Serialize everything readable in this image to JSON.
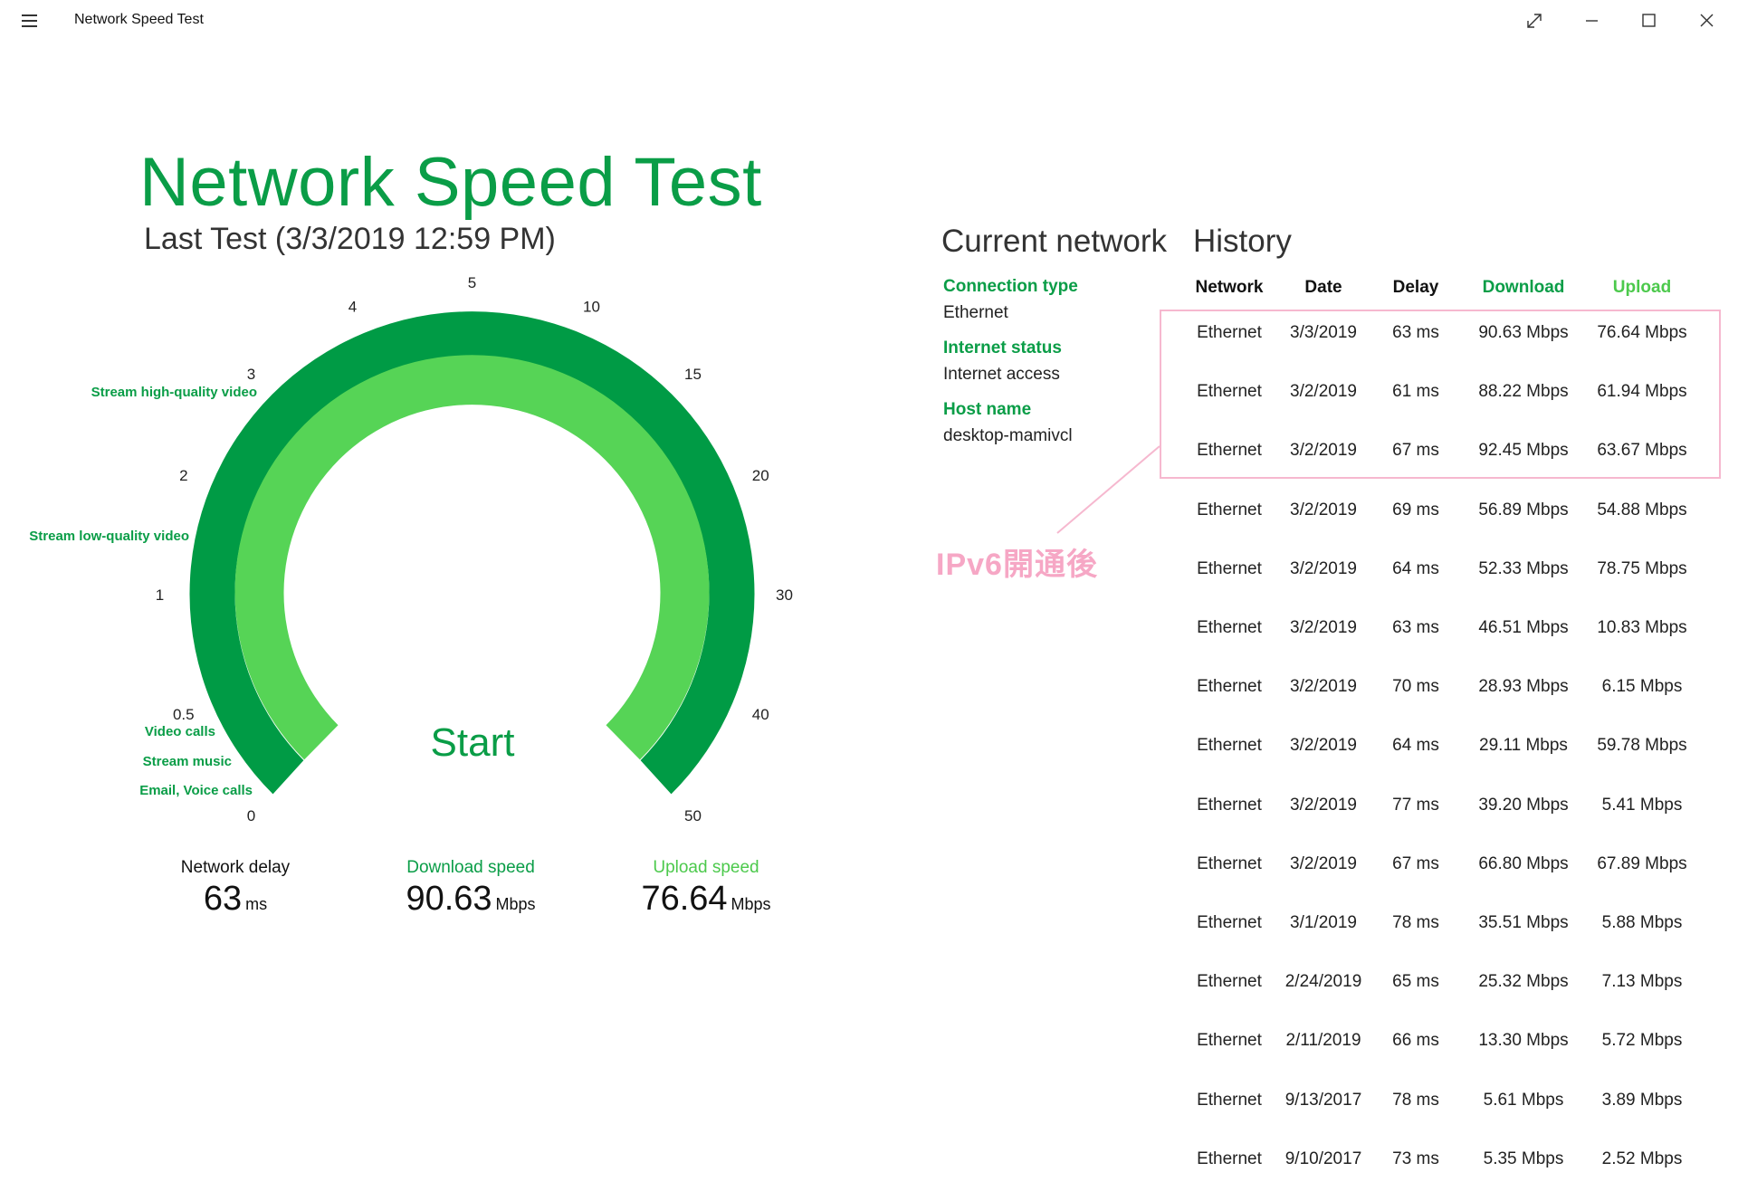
{
  "window": {
    "title": "Network Speed Test"
  },
  "header": {
    "title": "Network Speed Test",
    "last_test": "Last Test (3/3/2019 12:59 PM)"
  },
  "gauge": {
    "ticks": [
      {
        "label": "0",
        "value": 0
      },
      {
        "label": "0.5",
        "value": 0.5
      },
      {
        "label": "1",
        "value": 1
      },
      {
        "label": "2",
        "value": 2
      },
      {
        "label": "3",
        "value": 3
      },
      {
        "label": "4",
        "value": 4
      },
      {
        "label": "5",
        "value": 5
      },
      {
        "label": "10",
        "value": 10
      },
      {
        "label": "15",
        "value": 15
      },
      {
        "label": "20",
        "value": 20
      },
      {
        "label": "30",
        "value": 30
      },
      {
        "label": "40",
        "value": 40
      },
      {
        "label": "50",
        "value": 50
      }
    ],
    "markers": [
      {
        "label": "Stream high-quality video"
      },
      {
        "label": "Stream low-quality video"
      },
      {
        "label": "Video calls"
      },
      {
        "label": "Stream music"
      },
      {
        "label": "Email, Voice calls"
      }
    ],
    "start_label": "Start",
    "colors": {
      "outer": "#009b45",
      "inner": "#56d456"
    }
  },
  "metrics": {
    "delay": {
      "label": "Network delay",
      "value": "63",
      "unit": "ms"
    },
    "download": {
      "label": "Download speed",
      "value": "90.63",
      "unit": "Mbps"
    },
    "upload": {
      "label": "Upload speed",
      "value": "76.64",
      "unit": "Mbps"
    }
  },
  "current_network": {
    "title": "Current network",
    "connection_type_label": "Connection type",
    "connection_type": "Ethernet",
    "internet_status_label": "Internet status",
    "internet_status": "Internet access",
    "host_name_label": "Host name",
    "host_name": "desktop-mamivcl"
  },
  "history": {
    "title": "History",
    "headers": [
      "Network",
      "Date",
      "Delay",
      "Download",
      "Upload"
    ],
    "rows": [
      [
        "Ethernet",
        "3/3/2019",
        "63 ms",
        "90.63 Mbps",
        "76.64 Mbps"
      ],
      [
        "Ethernet",
        "3/2/2019",
        "61 ms",
        "88.22 Mbps",
        "61.94 Mbps"
      ],
      [
        "Ethernet",
        "3/2/2019",
        "67 ms",
        "92.45 Mbps",
        "63.67 Mbps"
      ],
      [
        "Ethernet",
        "3/2/2019",
        "69 ms",
        "56.89 Mbps",
        "54.88 Mbps"
      ],
      [
        "Ethernet",
        "3/2/2019",
        "64 ms",
        "52.33 Mbps",
        "78.75 Mbps"
      ],
      [
        "Ethernet",
        "3/2/2019",
        "63 ms",
        "46.51 Mbps",
        "10.83 Mbps"
      ],
      [
        "Ethernet",
        "3/2/2019",
        "70 ms",
        "28.93 Mbps",
        "6.15 Mbps"
      ],
      [
        "Ethernet",
        "3/2/2019",
        "64 ms",
        "29.11 Mbps",
        "59.78 Mbps"
      ],
      [
        "Ethernet",
        "3/2/2019",
        "77 ms",
        "39.20 Mbps",
        "5.41 Mbps"
      ],
      [
        "Ethernet",
        "3/2/2019",
        "67 ms",
        "66.80 Mbps",
        "67.89 Mbps"
      ],
      [
        "Ethernet",
        "3/1/2019",
        "78 ms",
        "35.51 Mbps",
        "5.88 Mbps"
      ],
      [
        "Ethernet",
        "2/24/2019",
        "65 ms",
        "25.32 Mbps",
        "7.13 Mbps"
      ],
      [
        "Ethernet",
        "2/11/2019",
        "66 ms",
        "13.30 Mbps",
        "5.72 Mbps"
      ],
      [
        "Ethernet",
        "9/13/2017",
        "78 ms",
        "5.61 Mbps",
        "3.89 Mbps"
      ],
      [
        "Ethernet",
        "9/10/2017",
        "73 ms",
        "5.35 Mbps",
        "2.52 Mbps"
      ]
    ]
  },
  "annotation": {
    "text": "IPv6開通後",
    "color": "#f6a7c5"
  },
  "colors": {
    "accent_dark": "#0a9d47",
    "accent_light": "#4cc94c"
  }
}
